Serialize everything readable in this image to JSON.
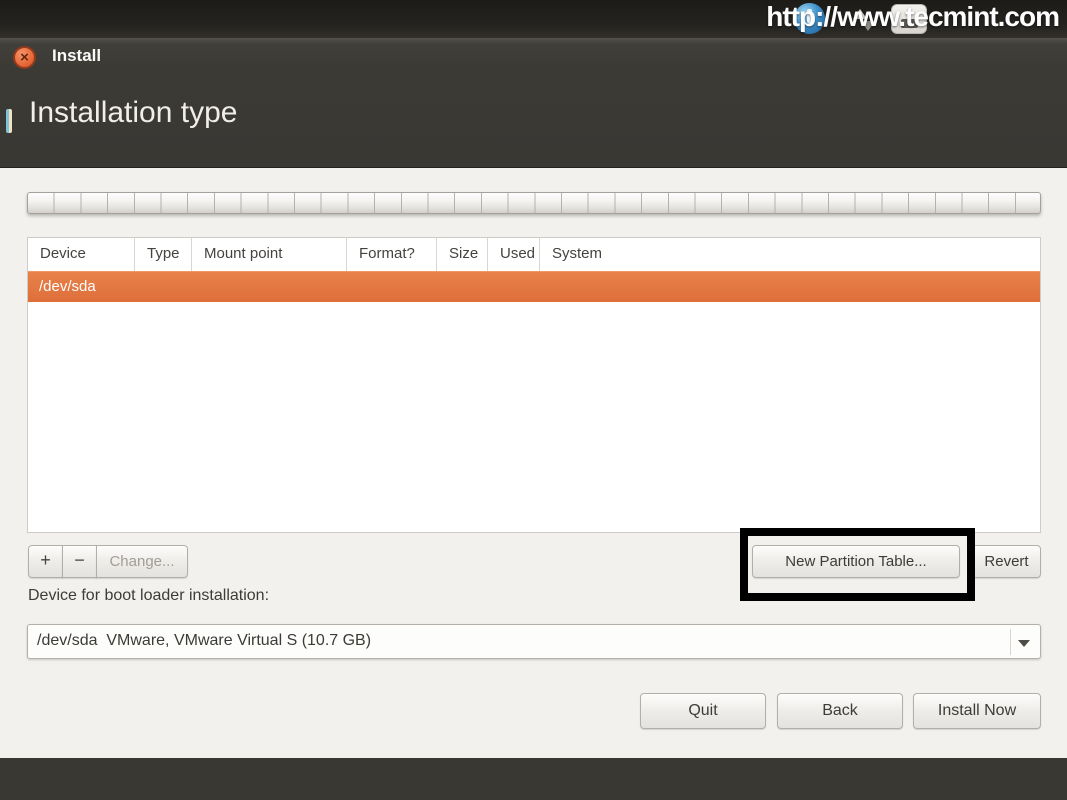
{
  "watermark": {
    "text": "http://www.tecmint.com"
  },
  "window": {
    "title": "Install"
  },
  "page": {
    "title": "Installation type"
  },
  "icons": {
    "close_glyph": "×",
    "dropdown_arrow": "triangle-down",
    "tray": [
      "indicator-blue",
      "network-arrows",
      "keyboard-indicator"
    ]
  },
  "table": {
    "headers": [
      "Device",
      "Type",
      "Mount point",
      "Format?",
      "Size",
      "Used",
      "System"
    ],
    "row": {
      "device": "/dev/sda",
      "selected": true
    }
  },
  "toolbar": {
    "add_label": "+",
    "remove_label": "−",
    "change_label": "Change...",
    "new_partition_table_label": "New Partition Table...",
    "revert_label": "Revert"
  },
  "boot_loader": {
    "label": "Device for boot loader installation:",
    "selected_device": "/dev/sda  VMware, VMware Virtual S (10.7 GB)"
  },
  "actions": {
    "quit_label": "Quit",
    "back_label": "Back",
    "install_now_label": "Install Now"
  },
  "colors": {
    "accent_orange": "#e4753e",
    "header_dark": "#3c3a35",
    "content_bg": "#f2f1ee",
    "highlight_annotation": "#000000",
    "close_button": "#ea6c3c"
  }
}
